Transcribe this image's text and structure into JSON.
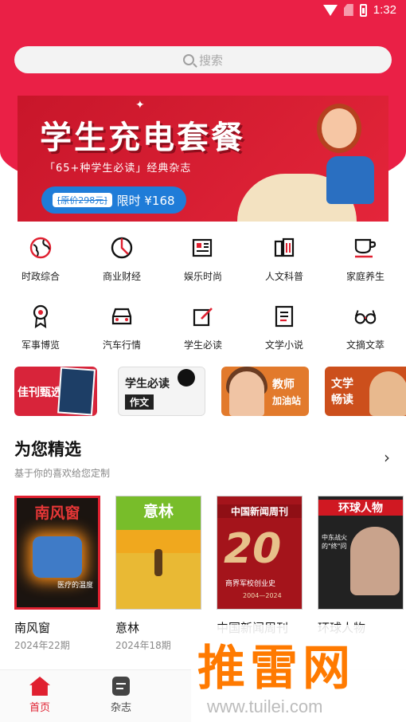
{
  "status_bar": {
    "time": "1:32",
    "icons": [
      "wifi-icon",
      "no-sim-icon",
      "battery-charging-icon"
    ]
  },
  "search": {
    "placeholder": "搜索"
  },
  "banner": {
    "title": "学生充电套餐",
    "subtitle": "「65+种学生必读」经典杂志",
    "original_price": "[原价298元]",
    "offer": "限时 ¥168"
  },
  "categories": [
    {
      "label": "时政综合",
      "icon": "globe-icon"
    },
    {
      "label": "商业财经",
      "icon": "pie-chart-icon"
    },
    {
      "label": "娱乐时尚",
      "icon": "newspaper-icon"
    },
    {
      "label": "人文科普",
      "icon": "building-icon"
    },
    {
      "label": "家庭养生",
      "icon": "teacup-icon"
    },
    {
      "label": "军事博览",
      "icon": "medal-icon"
    },
    {
      "label": "汽车行情",
      "icon": "car-icon"
    },
    {
      "label": "学生必读",
      "icon": "edit-icon"
    },
    {
      "label": "文学小说",
      "icon": "document-icon"
    },
    {
      "label": "文摘文萃",
      "icon": "glasses-icon"
    }
  ],
  "features": [
    {
      "label": "佳刊甄选",
      "sub": ""
    },
    {
      "label": "学生必读",
      "sub": "作文"
    },
    {
      "label": "教师",
      "sub": "加油站"
    },
    {
      "label": "文学畅读",
      "sub": ""
    }
  ],
  "section": {
    "title": "为您精选",
    "subtitle": "基于你的喜欢给您定制"
  },
  "magazines": [
    {
      "name": "南风窗",
      "issue": "2024年22期",
      "cover_title": "南风窗",
      "cover_caption": "医疗的温度"
    },
    {
      "name": "意林",
      "issue": "2024年18期",
      "cover_title": "意林"
    },
    {
      "name": "中国新闻周刊",
      "issue": "",
      "cover_title": "中国新闻周刊",
      "cover_caption": "商界军校创业史",
      "cover_number": "20",
      "cover_years": "2004—2024"
    },
    {
      "name": "环球人物",
      "issue": "",
      "cover_title": "环球人物",
      "cover_caption": "中东战火的\"终\"问"
    }
  ],
  "bottom_nav": [
    {
      "label": "首页",
      "active": true
    },
    {
      "label": "杂志",
      "active": false
    }
  ],
  "watermark": {
    "text": "推雷网",
    "url": "www.tuilei.com"
  },
  "colors": {
    "brand_red": "#ea2046",
    "watermark_orange": "#ff7a00"
  }
}
